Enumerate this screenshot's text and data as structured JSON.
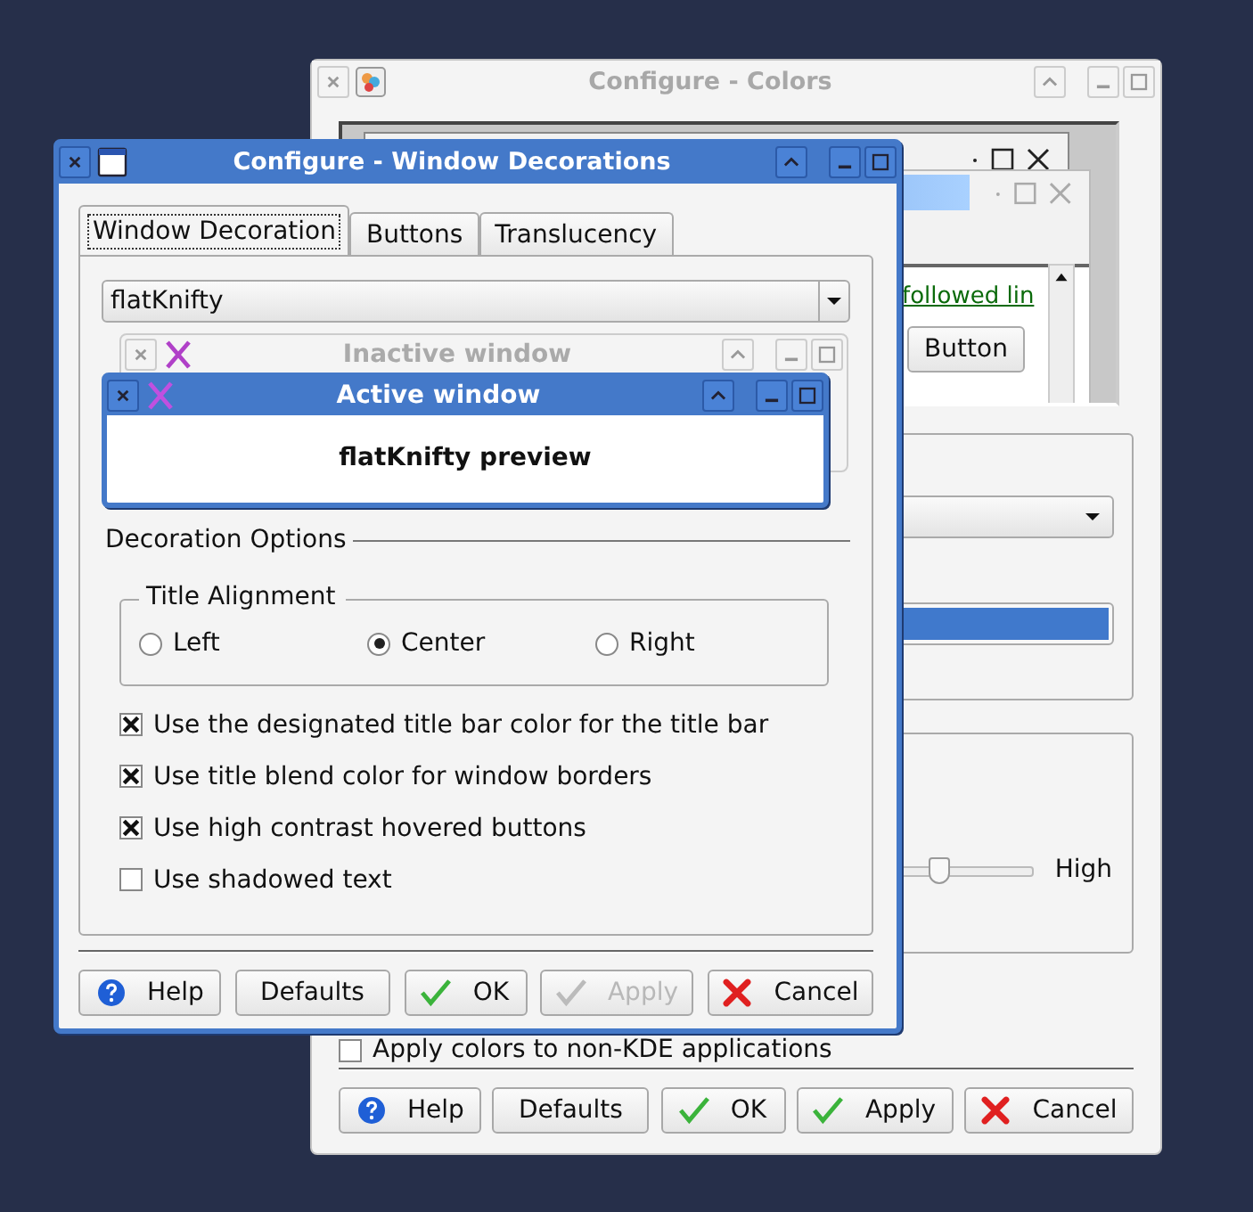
{
  "colors_window": {
    "title": "Configure - Colors",
    "active": false,
    "preview": {
      "link_text": "followed lin",
      "button_label": "Button"
    },
    "slider": {
      "level": 0.65,
      "label": "High"
    },
    "apply_checkbox": {
      "label": "Apply colors to non-KDE applications",
      "checked": false
    },
    "buttons": [
      {
        "label": "Help",
        "kind": "help",
        "disabled": false
      },
      {
        "label": "Defaults",
        "kind": "plain",
        "disabled": false
      },
      {
        "label": "OK",
        "kind": "ok",
        "disabled": false
      },
      {
        "label": "Apply",
        "kind": "apply",
        "disabled": false
      },
      {
        "label": "Cancel",
        "kind": "cancel",
        "disabled": false
      }
    ]
  },
  "decorations_window": {
    "title": "Configure - Window Decorations",
    "active": true,
    "tabs": [
      {
        "label": "Window Decoration",
        "selected": true
      },
      {
        "label": "Buttons",
        "selected": false
      },
      {
        "label": "Translucency",
        "selected": false
      }
    ],
    "decoration_select": "flatKnifty",
    "preview": {
      "inactive_title": "Inactive window",
      "active_title": "Active window",
      "text": "flatKnifty preview"
    },
    "options_heading": "Decoration Options",
    "alignment": {
      "title": "Title Alignment",
      "options": [
        {
          "label": "Left",
          "selected": false
        },
        {
          "label": "Center",
          "selected": true
        },
        {
          "label": "Right",
          "selected": false
        }
      ]
    },
    "checkboxes": [
      {
        "label": "Use the designated title bar color for the title bar",
        "checked": true
      },
      {
        "label": "Use title blend color for window borders",
        "checked": true
      },
      {
        "label": "Use high contrast hovered buttons",
        "checked": true
      },
      {
        "label": "Use shadowed text",
        "checked": false
      }
    ],
    "buttons": [
      {
        "label": "Help",
        "kind": "help",
        "disabled": false
      },
      {
        "label": "Defaults",
        "kind": "plain",
        "disabled": false
      },
      {
        "label": "OK",
        "kind": "ok",
        "disabled": false
      },
      {
        "label": "Apply",
        "kind": "apply",
        "disabled": true
      },
      {
        "label": "Cancel",
        "kind": "cancel",
        "disabled": false
      }
    ]
  }
}
